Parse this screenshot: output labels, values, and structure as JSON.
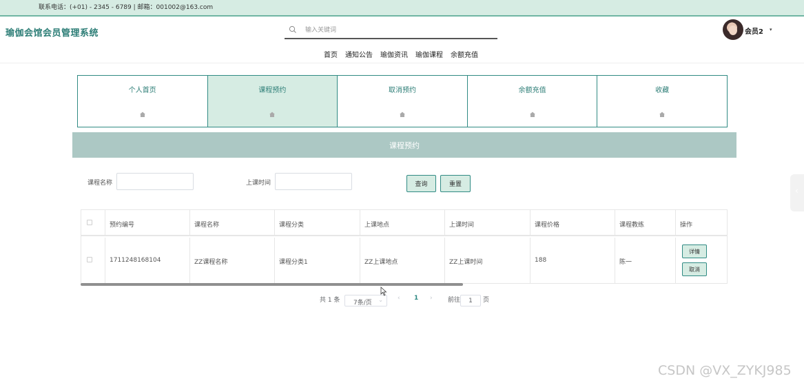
{
  "topbar": {
    "contact": "联系电话：(+01) - 2345 - 6789 | 邮箱：001002@163.com"
  },
  "header": {
    "site_title": "瑜伽会馆会员管理系统",
    "search_placeholder": "输入关键词",
    "user_name": "会员2",
    "user_caret": "▾"
  },
  "nav": [
    "首页",
    "通知公告",
    "瑜伽资讯",
    "瑜伽课程",
    "余额充值"
  ],
  "tabs": [
    {
      "label": "个人首页",
      "active": false
    },
    {
      "label": "课程预约",
      "active": true
    },
    {
      "label": "取消预约",
      "active": false
    },
    {
      "label": "余额充值",
      "active": false
    },
    {
      "label": "收藏",
      "active": false
    }
  ],
  "section_title": "课程预约",
  "filters": {
    "course_name_label": "课程名称",
    "course_name_value": "",
    "class_time_label": "上课时间",
    "class_time_value": "",
    "query_button": "查询",
    "reset_button": "重置"
  },
  "table": {
    "headers": [
      "预约编号",
      "课程名称",
      "课程分类",
      "上课地点",
      "上课时间",
      "课程价格",
      "课程教练",
      "操作"
    ],
    "rows": [
      {
        "booking_id": "1711248168104",
        "course_name": "ZZ课程名称",
        "category": "课程分类1",
        "location": "ZZ上课地点",
        "time": "ZZ上课时间",
        "price": "188",
        "coach": "陈一",
        "detail_button": "详情",
        "cancel_button": "取消"
      }
    ]
  },
  "pagination": {
    "total": "共 1 条",
    "page_size": "7条/页",
    "prev": "‹",
    "current_page": "1",
    "next": "›",
    "goto_label": "前往",
    "goto_value": "1",
    "page_suffix": "页"
  },
  "side_handle": "‹",
  "watermark": "CSDN @VX_ZYKJ985",
  "colors": {
    "accent": "#2f8a83",
    "accent_bg": "#d6ece3",
    "header_band": "#acc8c4"
  }
}
